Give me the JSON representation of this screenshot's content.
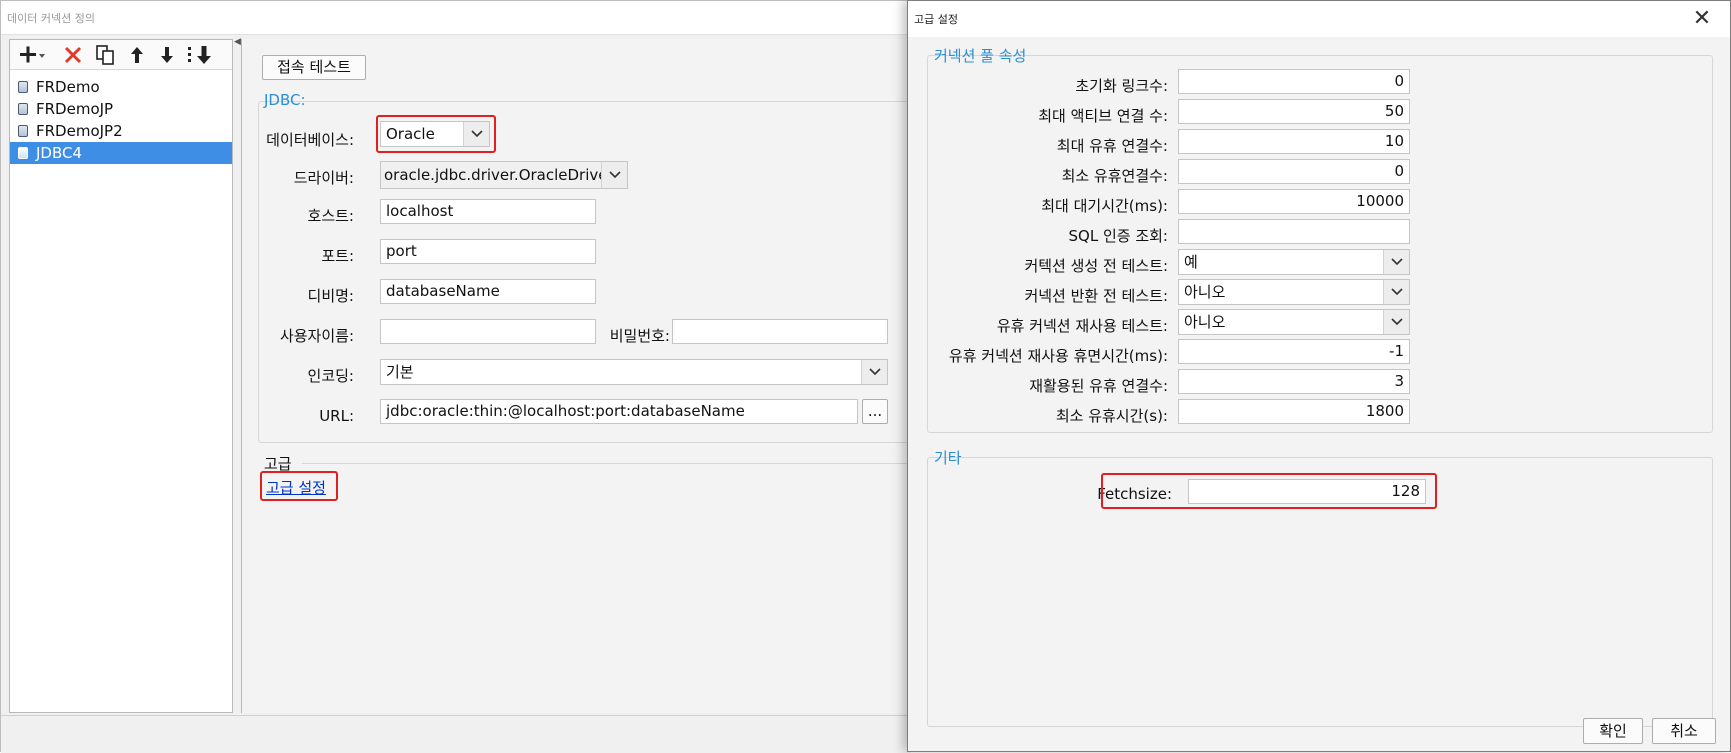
{
  "main_window": {
    "title": "데이터 커넥션 정의",
    "connections": [
      "FRDemo",
      "FRDemoJP",
      "FRDemoJP2",
      "JDBC4"
    ],
    "test_button": "접속 테스트",
    "jdbc_group": "JDBC:",
    "labels": {
      "database": "데이터베이스:",
      "driver": "드라이버:",
      "host": "호스트:",
      "port": "포트:",
      "dbname": "디비명:",
      "username": "사용자이름:",
      "password": "비밀번호:",
      "encoding": "인코딩:",
      "url": "URL:"
    },
    "values": {
      "database": "Oracle",
      "driver": "oracle.jdbc.driver.OracleDriver",
      "host": "localhost",
      "port": "port",
      "dbname": "databaseName",
      "username": "",
      "password": "",
      "encoding": "기본",
      "url": "jdbc:oracle:thin:@localhost:port:databaseName"
    },
    "url_button": "...",
    "advanced_section": "고급",
    "advanced_link": "고급 설정"
  },
  "dialog": {
    "title": "고급 설정",
    "close": "✕",
    "pool_group": "커넥션 풀 속성",
    "pool_rows": [
      {
        "label": "초기화 링크수:",
        "value": "0",
        "type": "text"
      },
      {
        "label": "최대 액티브 연결 수:",
        "value": "50",
        "type": "text"
      },
      {
        "label": "최대 유휴 연결수:",
        "value": "10",
        "type": "text"
      },
      {
        "label": "최소 유휴연결수:",
        "value": "0",
        "type": "text"
      },
      {
        "label": "최대 대기시간(ms):",
        "value": "10000",
        "type": "text"
      },
      {
        "label": "SQL 인증 조회:",
        "value": "",
        "type": "text"
      },
      {
        "label": "커텍션 생성 전 테스트:",
        "value": "예",
        "type": "combo"
      },
      {
        "label": "커넥션 반환 전 테스트:",
        "value": "아니오",
        "type": "combo"
      },
      {
        "label": "유휴 커넥션 재사용 테스트:",
        "value": "아니오",
        "type": "combo"
      },
      {
        "label": "유휴 커넥션 재사용 휴면시간(ms):",
        "value": "-1",
        "type": "text"
      },
      {
        "label": "재활용된 유휴 연결수:",
        "value": "3",
        "type": "text"
      },
      {
        "label": "최소 유휴시간(s):",
        "value": "1800",
        "type": "text"
      }
    ],
    "other_group": "기타",
    "fetchsize_label": "Fetchsize:",
    "fetchsize_value": "128",
    "ok_button": "확인",
    "cancel_button": "취소"
  },
  "colors": {
    "accent_blue": "#2b8fd3",
    "selection": "#3e8ee6",
    "highlight_red": "#e02020",
    "link": "#0033cc"
  }
}
